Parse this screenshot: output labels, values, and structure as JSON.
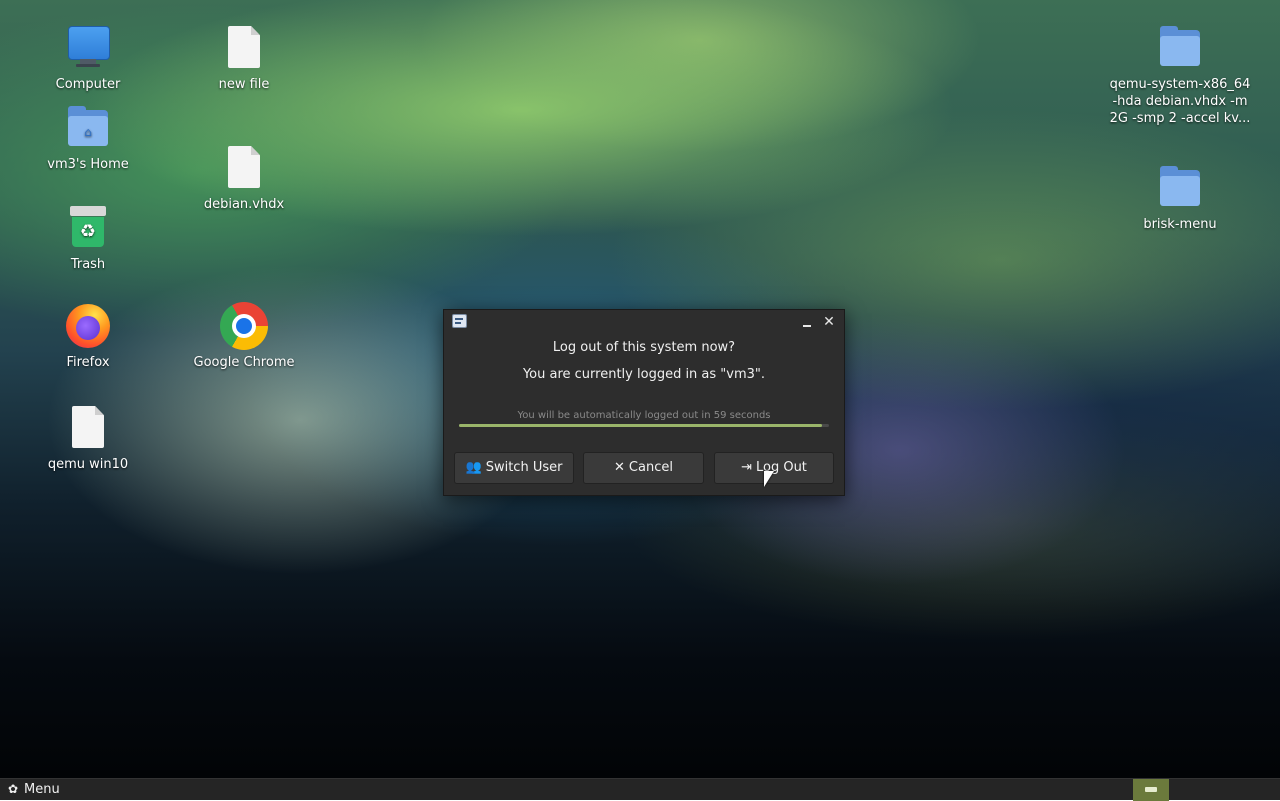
{
  "desktop": {
    "icons": [
      {
        "label": "Computer",
        "icon": "computer-icon"
      },
      {
        "label": "vm3's Home",
        "icon": "home-folder-icon"
      },
      {
        "label": "Trash",
        "icon": "trash-icon"
      },
      {
        "label": "Firefox",
        "icon": "firefox-icon"
      },
      {
        "label": "qemu win10",
        "icon": "file-icon"
      },
      {
        "label": "new file",
        "icon": "file-icon"
      },
      {
        "label": "debian.vhdx",
        "icon": "file-icon"
      },
      {
        "label": "Google Chrome",
        "icon": "chrome-icon"
      },
      {
        "label": "qemu-system-x86_64 -hda debian.vhdx -m 2G -smp 2 -accel kv...",
        "icon": "folder-icon"
      },
      {
        "label": "brisk-menu",
        "icon": "folder-icon"
      }
    ]
  },
  "dialog": {
    "heading": "Log out of this system now?",
    "subheading": "You are currently logged in as \"vm3\".",
    "countdown": "You will be automatically logged out in 59 seconds",
    "progress": 0.98,
    "buttons": {
      "switch_user": "Switch User",
      "cancel": "Cancel",
      "log_out": "Log Out"
    }
  },
  "taskbar": {
    "menu_label": "Menu"
  },
  "colors": {
    "dialog_bg": "#2d2d2d",
    "progress_fill": "#9ab56a",
    "taskbar_bg": "#252525",
    "tray_accent": "#6b7a3c"
  }
}
